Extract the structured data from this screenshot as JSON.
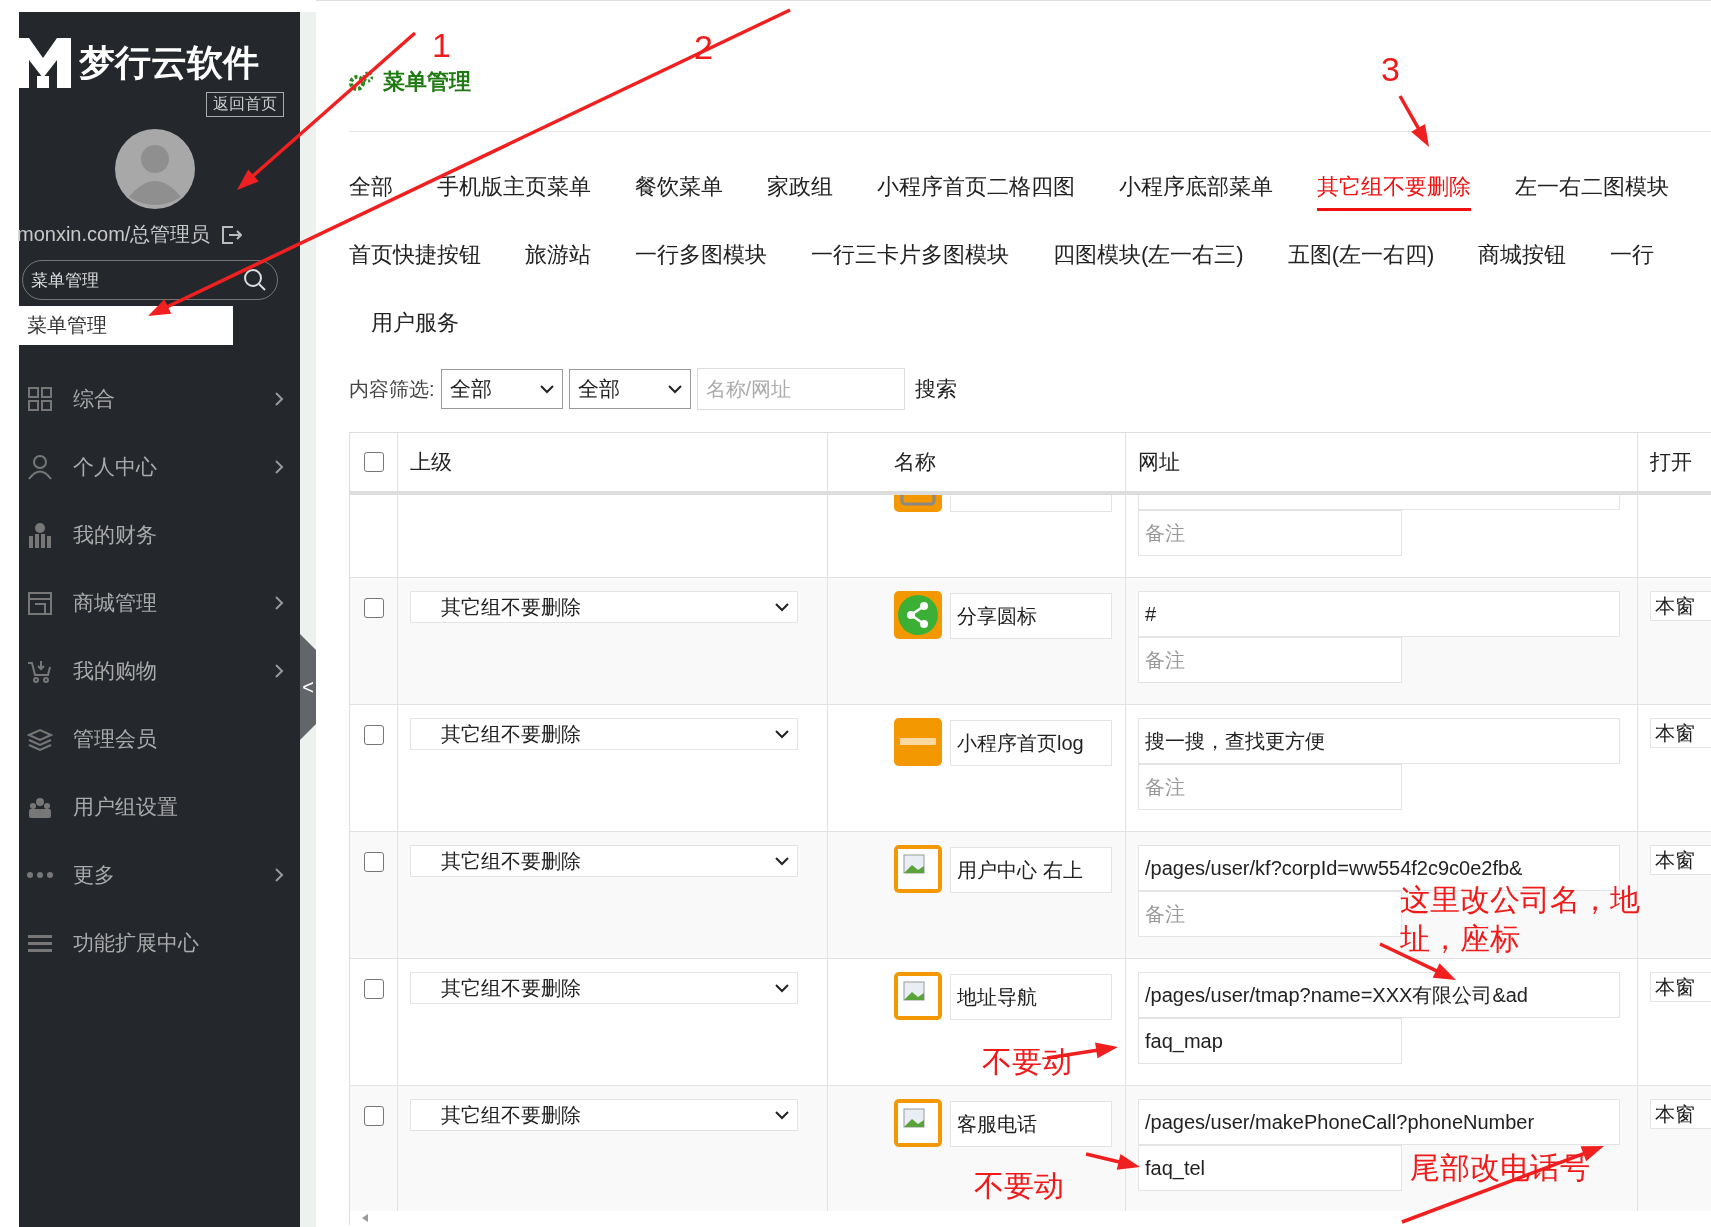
{
  "sidebar": {
    "logo": "梦行云软件",
    "home_link": "返回首页",
    "user": "monxin.com/总管理员",
    "search": {
      "value": "菜单管理"
    },
    "results": [
      {
        "label": "菜单管理",
        "selected": true
      }
    ],
    "items": [
      {
        "label": "综合",
        "kind": "grid",
        "expandable": true
      },
      {
        "label": "个人中心",
        "kind": "user",
        "expandable": true
      },
      {
        "label": "我的财务",
        "kind": "finance",
        "expandable": false
      },
      {
        "label": "商城管理",
        "kind": "store",
        "expandable": true
      },
      {
        "label": "我的购物",
        "kind": "cart",
        "expandable": true
      },
      {
        "label": "管理会员",
        "kind": "layers",
        "expandable": false
      },
      {
        "label": "用户组设置",
        "kind": "group",
        "expandable": false
      },
      {
        "label": "更多",
        "kind": "dots",
        "expandable": true
      },
      {
        "label": "功能扩展中心",
        "kind": "lines",
        "expandable": false
      }
    ],
    "collapse": "<"
  },
  "main": {
    "title": "菜单管理",
    "tab_rows": [
      [
        {
          "label": "全部",
          "selected": false
        },
        {
          "label": "手机版主页菜单",
          "selected": false
        },
        {
          "label": "餐饮菜单",
          "selected": false
        },
        {
          "label": "家政组",
          "selected": false
        },
        {
          "label": "小程序首页二格四图",
          "selected": false
        },
        {
          "label": "小程序底部菜单",
          "selected": false
        },
        {
          "label": "其它组不要删除",
          "selected": true
        },
        {
          "label": "左一右二图模块",
          "selected": false
        }
      ],
      [
        {
          "label": "首页快捷按钮",
          "selected": false
        },
        {
          "label": "旅游站",
          "selected": false
        },
        {
          "label": "一行多图模块",
          "selected": false
        },
        {
          "label": "一行三卡片多图模块",
          "selected": false
        },
        {
          "label": "四图模块(左一右三)",
          "selected": false
        },
        {
          "label": "五图(左一右四)",
          "selected": false
        },
        {
          "label": "商城按钮",
          "selected": false
        },
        {
          "label": "一行",
          "selected": false
        }
      ],
      [
        {
          "label": "用户服务",
          "selected": false
        }
      ]
    ],
    "filter": {
      "label": "内容筛选:",
      "selects": [
        "全部",
        "全部"
      ],
      "search": {
        "placeholder": "名称/网址"
      },
      "button": "搜索"
    },
    "table": {
      "header_checked": false,
      "columns": [
        "上级",
        "名称",
        "网址",
        "打开"
      ],
      "rows": [
        {
          "kind": "frame",
          "note": {
            "placeholder": "备注"
          }
        },
        {
          "checked": false,
          "parent": "其它组不要删除",
          "kind": "share",
          "name": "分享圆标",
          "url": "#",
          "note": {
            "placeholder": "备注"
          },
          "open": "本窗"
        },
        {
          "checked": false,
          "parent": "其它组不要删除",
          "kind": "logo",
          "name": "小程序首页log",
          "url": "搜一搜，查找更方便",
          "note": {
            "placeholder": "备注"
          },
          "open": "本窗"
        },
        {
          "checked": false,
          "parent": "其它组不要删除",
          "kind": "image",
          "name": "用户中心 右上",
          "url": "/pages/user/kf?corpId=ww554f2c9c0e2fb&",
          "note": {
            "placeholder": "备注"
          },
          "open": "本窗"
        },
        {
          "checked": false,
          "parent": "其它组不要删除",
          "kind": "image",
          "name": "地址导航",
          "url": "/pages/user/tmap?name=XXX有限公司&ad",
          "note": {
            "value": "faq_map"
          },
          "open": "本窗"
        },
        {
          "checked": false,
          "parent": "其它组不要删除",
          "kind": "image",
          "name": "客服电话",
          "url": "/pages/user/makePhoneCall?phoneNumber",
          "note": {
            "value": "faq_tel"
          },
          "open": "本窗"
        }
      ]
    }
  },
  "annotations": [
    {
      "kind": "number",
      "text": "1"
    },
    {
      "kind": "number",
      "text": "2"
    },
    {
      "kind": "number",
      "text": "3"
    },
    {
      "kind": "note",
      "text": "这里改公司名，地址，座标"
    },
    {
      "kind": "note",
      "text": "不要动"
    },
    {
      "kind": "note",
      "text": "不要动"
    },
    {
      "kind": "note",
      "text": "尾部改电话号"
    }
  ]
}
